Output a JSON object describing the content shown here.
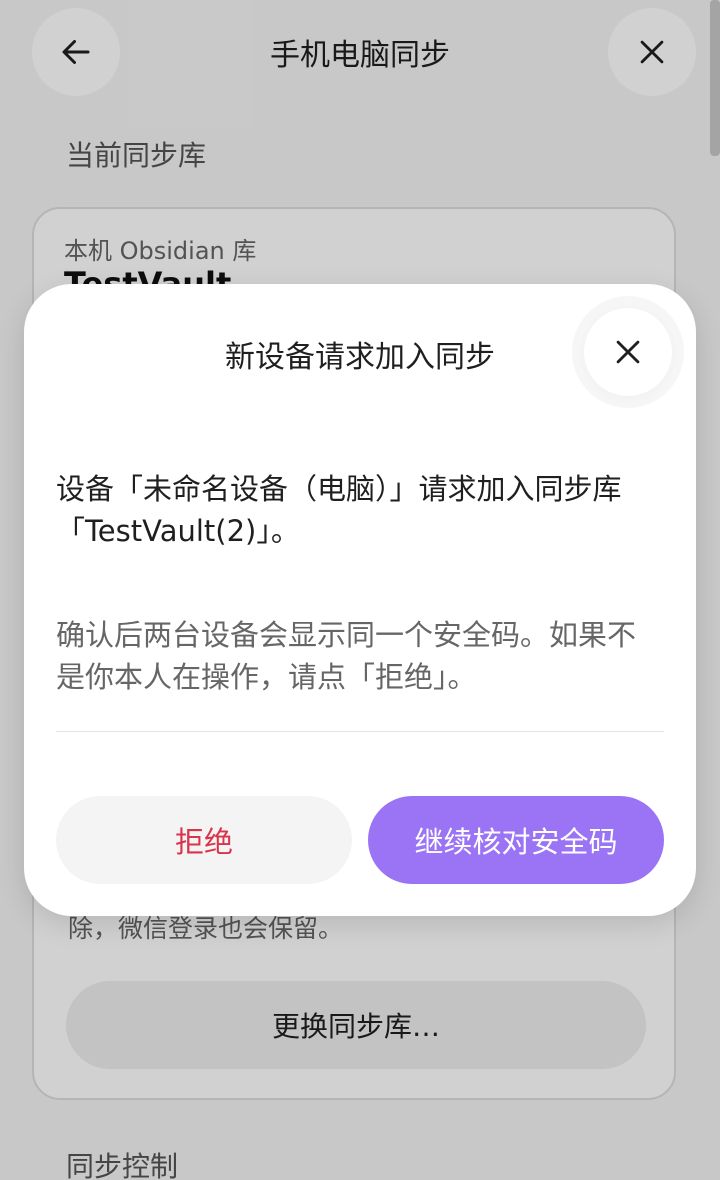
{
  "header": {
    "title": "手机电脑同步",
    "back_icon": "arrow-left-icon",
    "close_icon": "close-icon"
  },
  "sections": {
    "current_vault_label": "当前同步库",
    "sync_control_label": "同步控制"
  },
  "vault_card": {
    "caption": "本机 Obsidian 库",
    "name": "TestVault",
    "note_tail": "除，微信登录也会保留。",
    "change_button_label": "更换同步库…"
  },
  "dialog": {
    "title": "新设备请求加入同步",
    "message": "设备「未命名设备（电脑）」请求加入同步库「TestVault(2)」。",
    "hint": "确认后两台设备会显示同一个安全码。如果不是你本人在操作，请点「拒绝」。",
    "reject_label": "拒绝",
    "continue_label": "继续核对安全码"
  },
  "colors": {
    "accent": "#9b74f6",
    "danger": "#d9344a"
  }
}
